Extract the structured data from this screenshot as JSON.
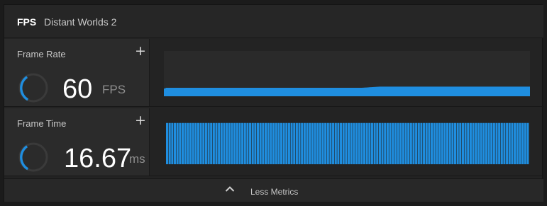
{
  "header": {
    "active_tab": "FPS",
    "app_title": "Distant Worlds 2"
  },
  "metrics": [
    {
      "label": "Frame Rate",
      "value": "60",
      "unit": "FPS",
      "add_icon": "plus-icon",
      "gauge_fill": 0.3
    },
    {
      "label": "Frame Time",
      "value": "16.67",
      "unit": "ms",
      "add_icon": "plus-icon",
      "gauge_fill": 0.3
    }
  ],
  "frame_rate_graph": {
    "type": "area",
    "color": "#1f8ee0",
    "values": [
      0.34,
      0.32,
      0.34,
      0.36,
      0.36,
      0.36,
      0.36,
      0.36,
      0.36,
      0.36,
      0.36,
      0.36,
      0.36,
      0.36,
      0.36,
      0.36,
      0.36,
      0.36,
      0.36,
      0.36,
      0.36,
      0.36,
      0.36,
      0.36,
      0.36,
      0.36,
      0.36,
      0.36,
      0.36,
      0.36,
      0.36,
      0.36,
      0.36,
      0.36,
      0.36,
      0.36,
      0.36,
      0.36,
      0.36,
      0.36,
      0.36,
      0.36,
      0.36,
      0.36,
      0.36,
      0.36,
      0.36,
      0.36,
      0.36,
      0.36,
      0.36,
      0.36,
      0.36,
      0.36,
      0.36,
      0.36,
      0.36,
      0.36,
      0.36,
      0.36,
      0.36,
      0.36,
      0.36,
      0.36,
      0.36,
      0.36,
      0.36,
      0.36,
      0.36,
      0.36,
      0.36,
      0.36,
      0.36,
      0.36,
      0.36,
      0.36,
      0.36,
      0.36,
      0.36,
      0.36,
      0.36,
      0.36,
      0.36,
      0.36,
      0.36,
      0.36,
      0.36,
      0.36,
      0.36,
      0.36,
      0.36,
      0.36,
      0.36,
      0.36,
      0.36,
      0.36,
      0.36,
      0.36,
      0.36,
      0.36,
      0.36,
      0.36,
      0.36,
      0.36,
      0.36,
      0.36,
      0.36,
      0.36,
      0.36,
      0.36,
      0.36,
      0.36,
      0.36,
      0.36,
      0.36,
      0.36,
      0.36,
      0.36,
      0.36,
      0.36,
      0.36,
      0.36,
      0.36,
      0.36,
      0.36,
      0.36,
      0.36,
      0.36,
      0.36,
      0.36,
      0.36,
      0.36,
      0.36,
      0.36,
      0.36,
      0.36,
      0.36,
      0.36,
      0.36,
      0.36,
      0.36,
      0.36,
      0.36,
      0.36,
      0.36,
      0.36,
      0.36,
      0.36,
      0.36,
      0.36,
      0.36,
      0.36,
      0.36,
      0.36,
      0.36,
      0.36,
      0.36,
      0.36,
      0.36,
      0.36,
      0.36,
      0.36,
      0.36,
      0.36,
      0.36,
      0.36,
      0.36,
      0.36,
      0.36,
      0.36,
      0.36,
      0.36,
      0.36,
      0.36,
      0.36,
      0.36,
      0.36,
      0.36,
      0.36,
      0.36,
      0.36,
      0.36,
      0.36,
      0.36,
      0.36,
      0.36,
      0.36,
      0.36,
      0.36,
      0.36,
      0.36,
      0.36,
      0.36,
      0.36,
      0.36,
      0.36,
      0.36,
      0.36,
      0.36,
      0.36,
      0.36,
      0.36,
      0.36,
      0.36,
      0.36,
      0.36,
      0.36,
      0.36,
      0.36,
      0.36,
      0.36,
      0.36,
      0.36,
      0.36,
      0.36,
      0.36,
      0.36,
      0.36,
      0.36,
      0.36,
      0.36,
      0.36,
      0.36,
      0.36,
      0.36,
      0.36,
      0.36,
      0.36,
      0.36,
      0.36,
      0.36,
      0.36,
      0.36,
      0.36,
      0.36,
      0.36,
      0.36,
      0.36,
      0.36,
      0.36,
      0.36,
      0.36,
      0.36,
      0.36,
      0.36,
      0.36,
      0.36,
      0.36,
      0.36,
      0.36,
      0.36,
      0.36,
      0.36,
      0.36,
      0.36,
      0.36,
      0.36,
      0.36,
      0.36,
      0.36,
      0.36,
      0.36,
      0.36,
      0.36,
      0.36,
      0.36,
      0.36,
      0.36,
      0.36,
      0.36,
      0.36,
      0.36,
      0.36,
      0.36,
      0.36,
      0.36,
      0.36,
      0.36,
      0.36,
      0.36,
      0.36,
      0.36,
      0.36,
      0.36,
      0.36,
      0.36,
      0.36,
      0.36,
      0.36,
      0.36,
      0.36,
      0.36,
      0.36,
      0.36,
      0.36,
      0.36,
      0.36,
      0.36,
      0.36,
      0.36,
      0.36,
      0.36,
      0.36,
      0.36,
      0.36,
      0.36,
      0.36,
      0.36,
      0.36,
      0.36,
      0.36,
      0.36,
      0.36,
      0.36,
      0.36,
      0.36,
      0.36,
      0.36,
      0.36,
      0.36,
      0.36,
      0.36,
      0.36,
      0.36,
      0.36,
      0.36,
      0.36,
      0.36,
      0.36,
      0.36,
      0.36,
      0.36,
      0.36,
      0.36,
      0.36,
      0.36,
      0.36,
      0.36,
      0.36,
      0.36,
      0.36,
      0.36,
      0.36,
      0.36,
      0.36,
      0.36,
      0.36,
      0.36,
      0.36,
      0.36,
      0.36,
      0.36,
      0.36,
      0.36,
      0.36,
      0.36,
      0.36,
      0.36,
      0.36,
      0.36,
      0.36,
      0.36,
      0.36,
      0.36,
      0.36,
      0.36,
      0.36,
      0.36,
      0.36,
      0.36,
      0.36,
      0.36,
      0.36,
      0.36,
      0.36,
      0.36,
      0.36,
      0.36,
      0.36,
      0.36,
      0.36,
      0.36,
      0.36,
      0.36,
      0.36,
      0.36,
      0.36,
      0.36,
      0.36,
      0.36,
      0.36,
      0.36,
      0.36,
      0.36,
      0.36,
      0.36,
      0.36,
      0.36,
      0.36,
      0.36,
      0.36,
      0.36,
      0.36,
      0.36,
      0.36,
      0.36,
      0.36,
      0.36,
      0.36,
      0.36,
      0.36,
      0.36,
      0.36,
      0.36,
      0.36,
      0.36,
      0.36,
      0.36,
      0.36,
      0.36,
      0.36,
      0.36,
      0.36,
      0.36,
      0.36,
      0.36,
      0.36,
      0.36,
      0.36,
      0.36,
      0.36,
      0.36,
      0.36,
      0.36,
      0.36,
      0.36,
      0.36,
      0.36,
      0.36,
      0.36,
      0.36,
      0.36,
      0.36,
      0.36,
      0.36,
      0.36,
      0.36,
      0.36,
      0.36,
      0.36,
      0.36,
      0.36,
      0.36,
      0.36,
      0.36,
      0.36,
      0.36,
      0.36,
      0.36,
      0.36,
      0.36,
      0.36,
      0.36,
      0.36,
      0.36,
      0.36,
      0.36,
      0.36,
      0.36,
      0.36,
      0.36,
      0.36,
      0.36,
      0.36,
      0.36,
      0.36,
      0.36,
      0.36,
      0.36,
      0.36,
      0.36,
      0.36,
      0.36,
      0.36,
      0.36,
      0.36,
      0.36,
      0.36,
      0.36,
      0.36,
      0.36,
      0.36,
      0.36,
      0.36,
      0.36,
      0.36,
      0.36,
      0.36,
      0.36,
      0.36,
      0.36,
      0.36,
      0.36,
      0.36,
      0.36,
      0.36,
      0.36
    ]
  },
  "frame_time_graph": {
    "type": "bar",
    "color": "#1f8ee0",
    "bar_count": 140,
    "fill_level": 0.94
  },
  "footer": {
    "toggle_label": "Less Metrics",
    "icon": "chevron-up-icon"
  },
  "colors": {
    "accent": "#1f8ee0",
    "gauge_track": "#3a3a3a"
  }
}
